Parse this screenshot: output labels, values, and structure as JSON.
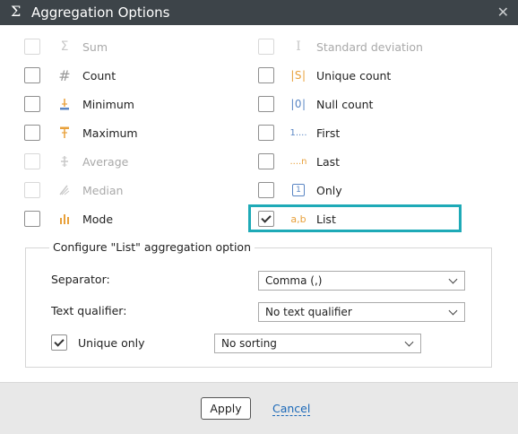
{
  "window": {
    "title": "Aggregation Options",
    "close_glyph": "✕"
  },
  "options_left": [
    {
      "label": "Sum",
      "icon": "sigma-icon",
      "enabled": false,
      "checked": false
    },
    {
      "label": "Count",
      "icon": "hash-icon",
      "enabled": true,
      "checked": false
    },
    {
      "label": "Minimum",
      "icon": "minimum-icon",
      "enabled": true,
      "checked": false
    },
    {
      "label": "Maximum",
      "icon": "maximum-icon",
      "enabled": true,
      "checked": false
    },
    {
      "label": "Average",
      "icon": "average-icon",
      "enabled": false,
      "checked": false
    },
    {
      "label": "Median",
      "icon": "median-icon",
      "enabled": false,
      "checked": false
    },
    {
      "label": "Mode",
      "icon": "bar-chart-icon",
      "enabled": true,
      "checked": false
    }
  ],
  "options_right": [
    {
      "label": "Standard deviation",
      "icon": "std-deviation-icon",
      "enabled": false,
      "checked": false
    },
    {
      "label": "Unique count",
      "icon": "unique-count-icon",
      "enabled": true,
      "checked": false
    },
    {
      "label": "Null count",
      "icon": "null-count-icon",
      "enabled": true,
      "checked": false
    },
    {
      "label": "First",
      "icon": "first-icon",
      "enabled": true,
      "checked": false
    },
    {
      "label": "Last",
      "icon": "last-icon",
      "enabled": true,
      "checked": false
    },
    {
      "label": "Only",
      "icon": "only-icon",
      "enabled": true,
      "checked": false
    },
    {
      "label": "List",
      "icon": "list-ab-icon",
      "enabled": true,
      "checked": true
    }
  ],
  "icon_glyphs": {
    "hash": "#",
    "sigma": "Σ",
    "std": "I",
    "unique": "|S|",
    "null": "|0|",
    "first": "1....",
    "last": "....n",
    "only": "1",
    "list": "a,b"
  },
  "config": {
    "legend": "Configure \"List\" aggregation option",
    "separator_label": "Separator:",
    "separator_value": "Comma (,)",
    "qualifier_label": "Text qualifier:",
    "qualifier_value": "No text qualifier",
    "unique_only_label": "Unique only",
    "unique_only_checked": true,
    "sorting_value": "No sorting"
  },
  "footer": {
    "apply_label": "Apply",
    "cancel_label": "Cancel"
  },
  "colors": {
    "titlebar": "#3d4449",
    "accent_icon": "#e8a03a",
    "highlight": "#1eaab7",
    "link": "#1a68b8"
  }
}
